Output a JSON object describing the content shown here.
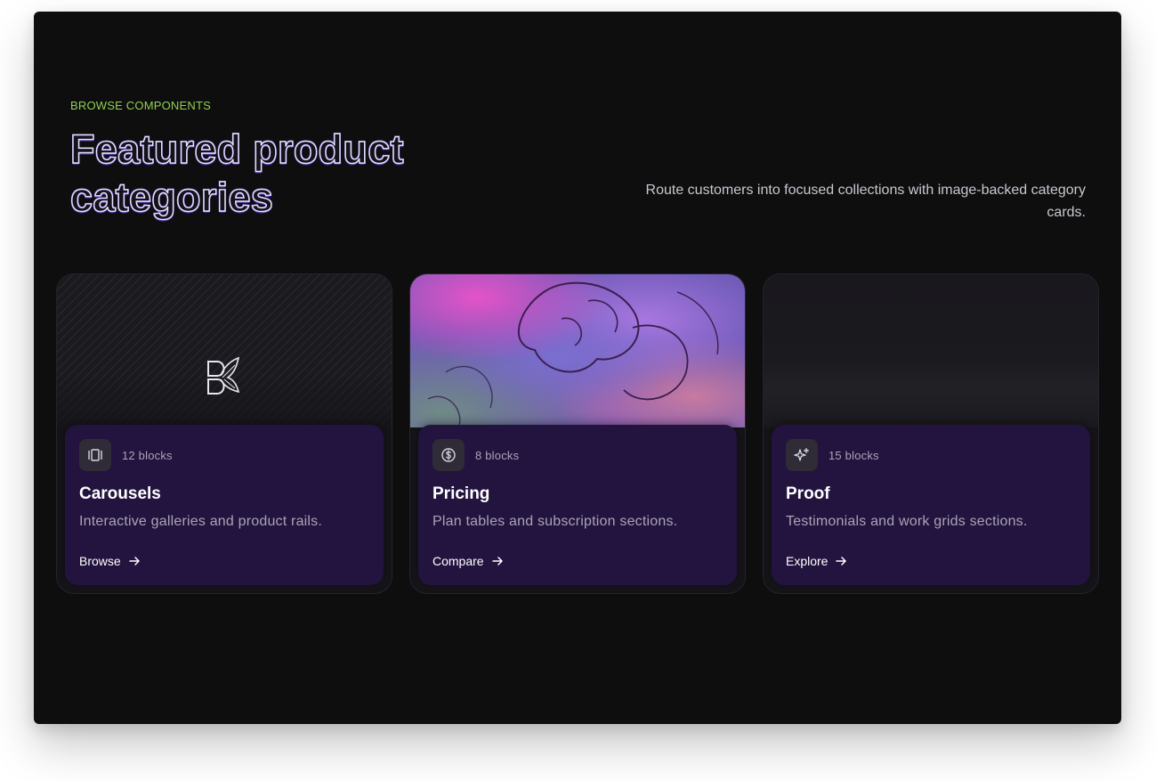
{
  "section": {
    "eyebrow": "BROWSE COMPONENTS",
    "title_line1": "Featured product",
    "title_line2": "categories",
    "intro": "Route customers into focused collections with image-backed category cards."
  },
  "cards": [
    {
      "count": "12 blocks",
      "title": "Carousels",
      "description": "Interactive galleries and product rails.",
      "cta": "Browse",
      "icon": "carousel-icon"
    },
    {
      "count": "8 blocks",
      "title": "Pricing",
      "description": "Plan tables and subscription sections.",
      "cta": "Compare",
      "icon": "dollar-circle-icon"
    },
    {
      "count": "15 blocks",
      "title": "Proof",
      "description": "Testimonials and work grids sections.",
      "cta": "Explore",
      "icon": "sparkles-icon"
    }
  ],
  "colors": {
    "accent": "#8fd14f",
    "panel_bg": "#0e0e0f",
    "card_body_bg": "#23133f"
  }
}
